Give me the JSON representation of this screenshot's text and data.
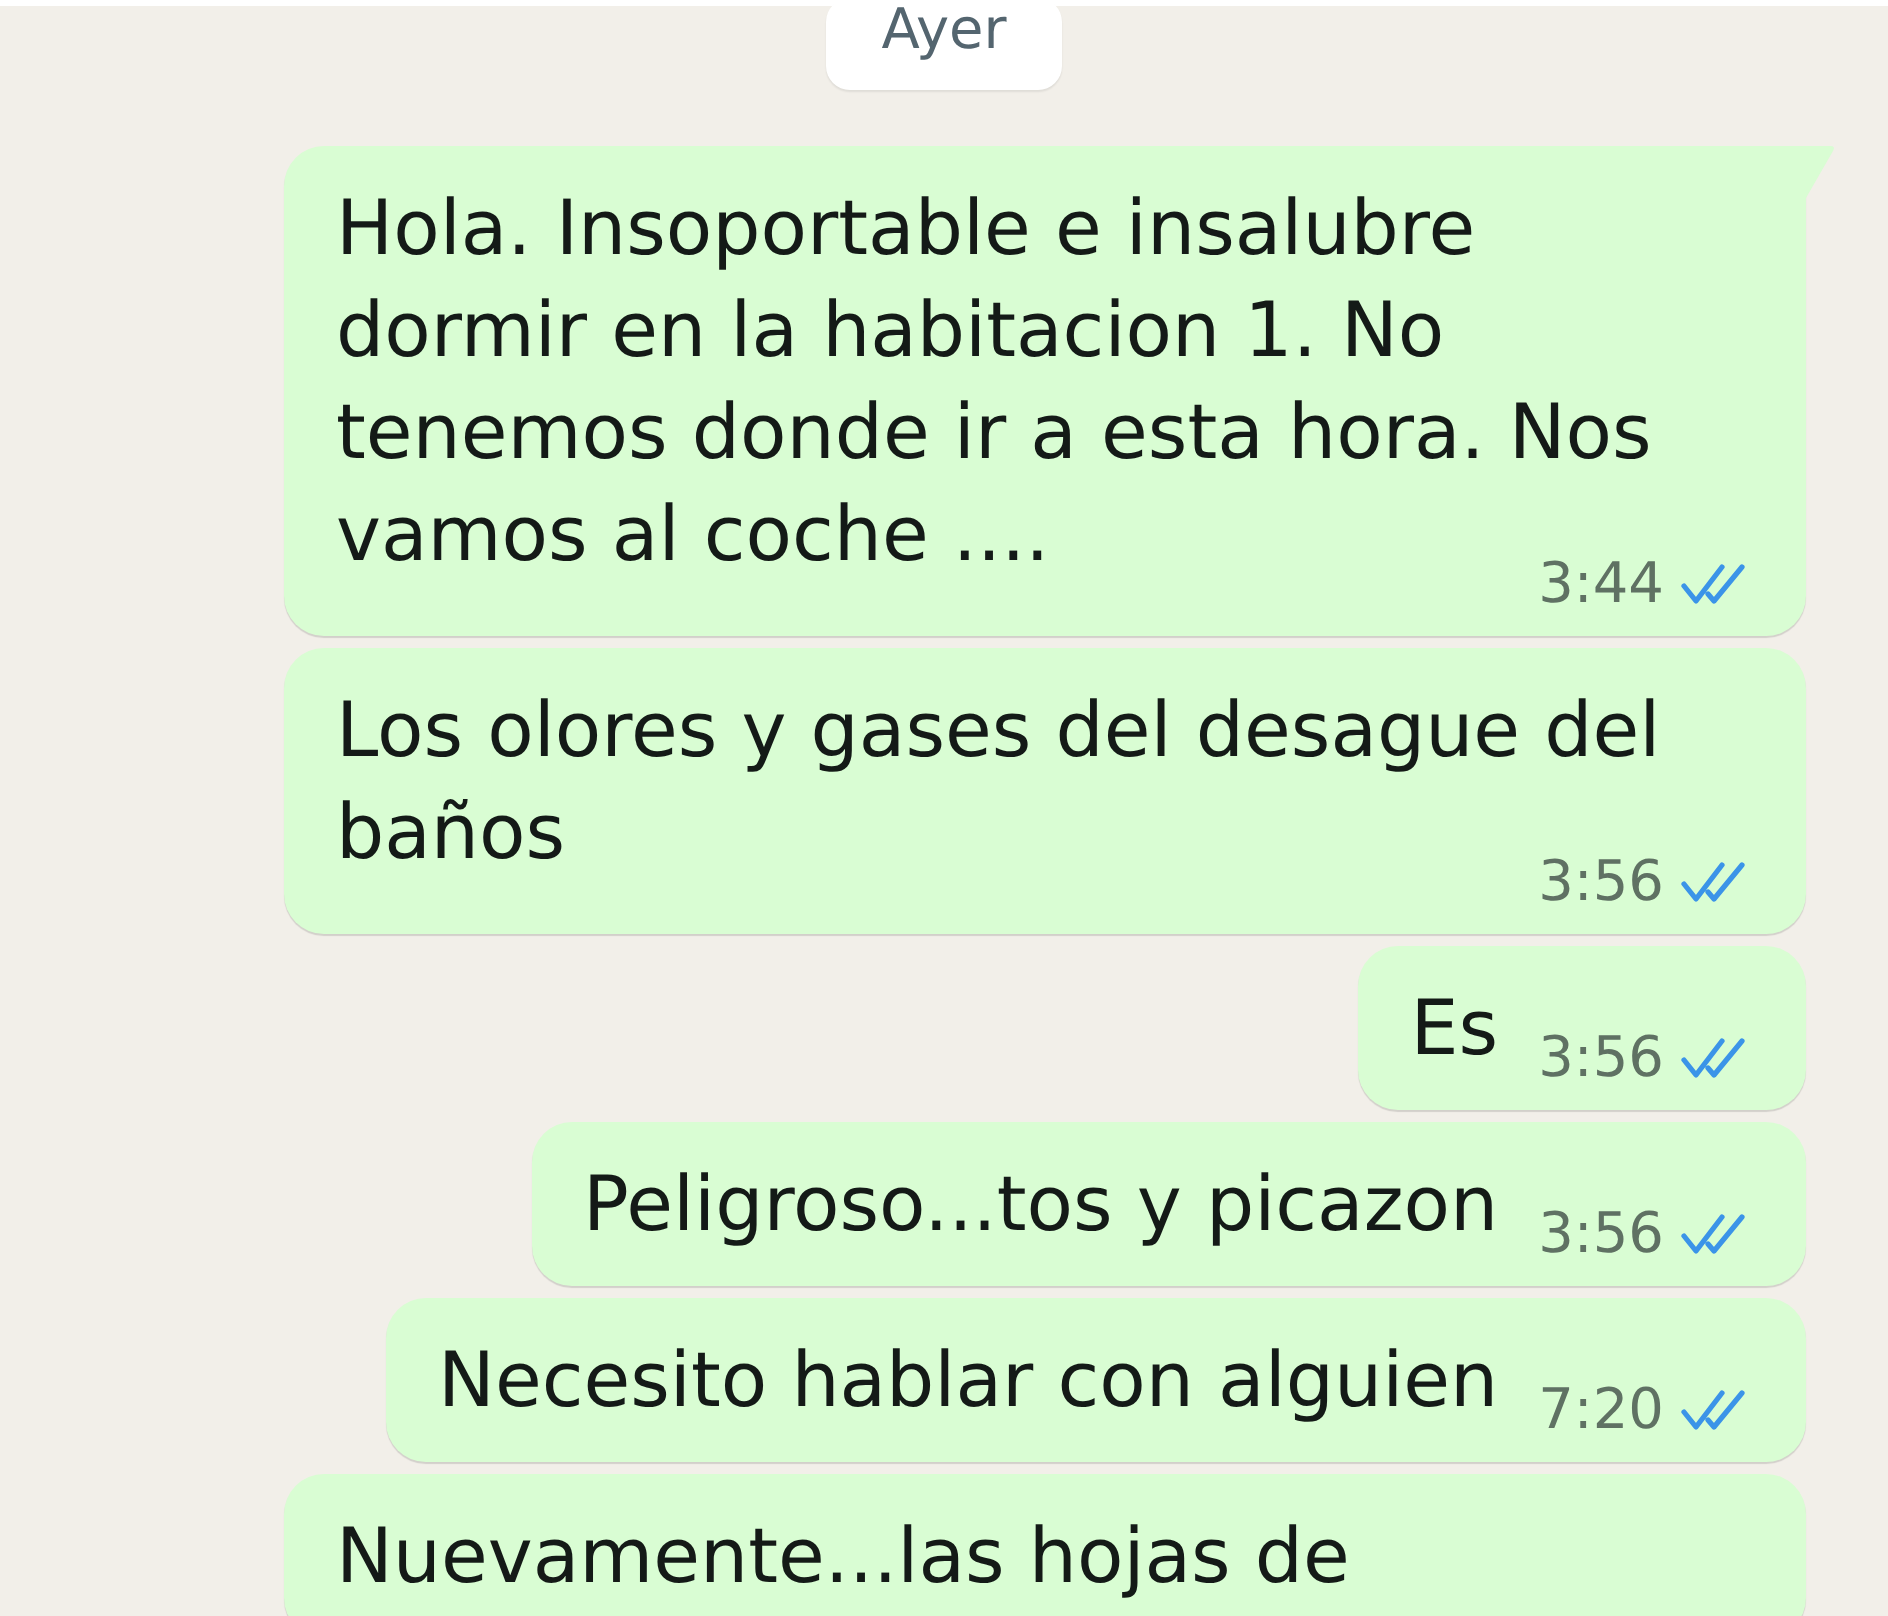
{
  "date_chip": {
    "label": "Ayer"
  },
  "messages": [
    {
      "text": "Hola. Insoportable e insalubre dormir en la habitacion 1. No tenemos donde ir a esta hora. Nos vamos al coche ....",
      "time": "3:44",
      "read": true,
      "tail": true,
      "truncated": false
    },
    {
      "text": "Los olores y gases del desague del baños",
      "time": "3:56",
      "read": true,
      "tail": false,
      "truncated": false
    },
    {
      "text": "Es",
      "time": "3:56",
      "read": true,
      "tail": false,
      "truncated": false
    },
    {
      "text": "Peligroso...tos y picazon",
      "time": "3:56",
      "read": true,
      "tail": false,
      "truncated": false
    },
    {
      "text": "Necesito hablar con alguien",
      "time": "7:20",
      "read": true,
      "tail": false,
      "truncated": false
    },
    {
      "text": "Nuevamente...las hojas de",
      "tail": false,
      "truncated": true
    }
  ]
}
